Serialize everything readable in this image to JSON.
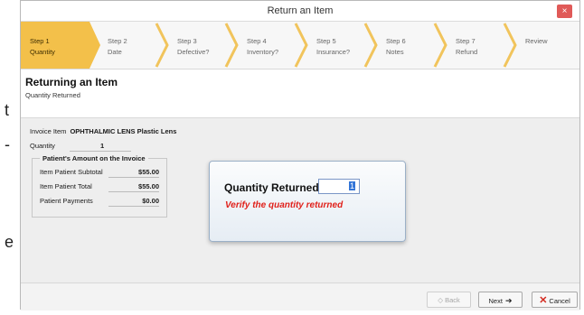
{
  "outside_text": [
    "t",
    "-",
    "e"
  ],
  "window": {
    "title": "Return an Item",
    "close_glyph": "×"
  },
  "steps": [
    {
      "num": "Step 1",
      "label": "Quantity",
      "active": true
    },
    {
      "num": "Step 2",
      "label": "Date"
    },
    {
      "num": "Step 3",
      "label": "Defective?"
    },
    {
      "num": "Step 4",
      "label": "Inventory?"
    },
    {
      "num": "Step 5",
      "label": "Insurance?"
    },
    {
      "num": "Step 6",
      "label": "Notes"
    },
    {
      "num": "Step 7",
      "label": "Refund"
    },
    {
      "num": "Review",
      "label": ""
    }
  ],
  "header": {
    "title": "Returning an Item",
    "subtitle": "Quantity Returned"
  },
  "invoice": {
    "item_label": "Invoice Item",
    "item_value": "OPHTHALMIC LENS Plastic Lens",
    "quantity_label": "Quantity",
    "quantity_value": "1"
  },
  "amount": {
    "title": "Patient's Amount on the Invoice",
    "rows": [
      {
        "label": "Item Patient Subtotal",
        "value": "$55.00"
      },
      {
        "label": "Item Patient Total",
        "value": "$55.00"
      },
      {
        "label": "Patient Payments",
        "value": "$0.00"
      }
    ]
  },
  "dialog": {
    "label": "Quantity Returned",
    "value": "1",
    "warning": "Verify the quantity returned"
  },
  "footer": {
    "back_label": "Back",
    "next_label": "Next",
    "cancel_label": "Cancel",
    "back_icon": "◇",
    "next_icon": "➔",
    "cancel_icon": "✕"
  },
  "colors": {
    "active_step": "#f3c04a",
    "warning": "#e0201a",
    "close": "#e05a58"
  }
}
